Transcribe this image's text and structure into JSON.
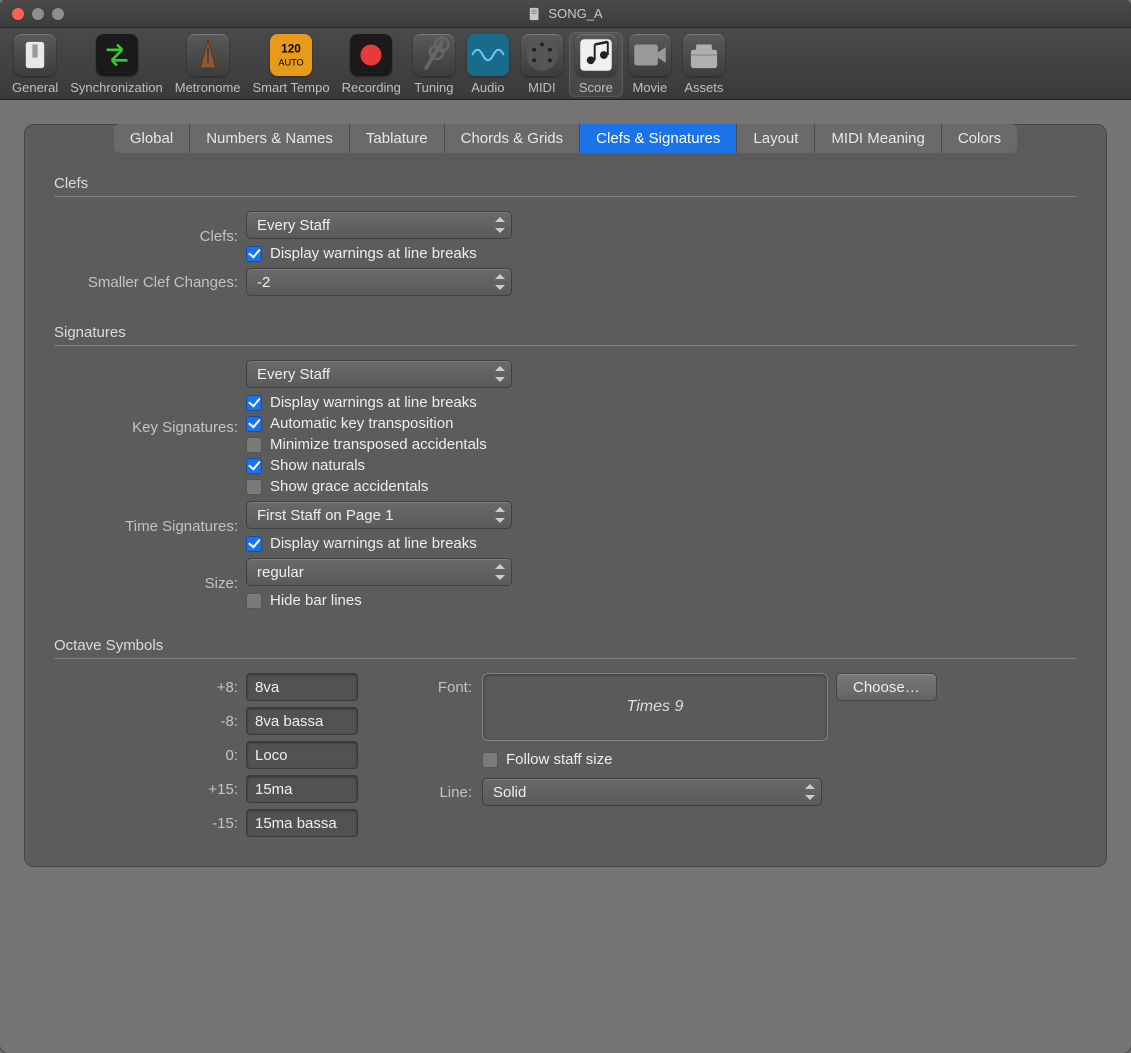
{
  "window_title": "SONG_A",
  "toolbar": [
    {
      "id": "general",
      "label": "General"
    },
    {
      "id": "sync",
      "label": "Synchronization"
    },
    {
      "id": "metronome",
      "label": "Metronome"
    },
    {
      "id": "smart-tempo",
      "label": "Smart Tempo"
    },
    {
      "id": "recording",
      "label": "Recording"
    },
    {
      "id": "tuning",
      "label": "Tuning"
    },
    {
      "id": "audio",
      "label": "Audio"
    },
    {
      "id": "midi",
      "label": "MIDI"
    },
    {
      "id": "score",
      "label": "Score",
      "active": true
    },
    {
      "id": "movie",
      "label": "Movie"
    },
    {
      "id": "assets",
      "label": "Assets"
    }
  ],
  "tabs": [
    "Global",
    "Numbers & Names",
    "Tablature",
    "Chords & Grids",
    "Clefs & Signatures",
    "Layout",
    "MIDI Meaning",
    "Colors"
  ],
  "active_tab": "Clefs & Signatures",
  "sections": {
    "clefs_title": "Clefs",
    "signatures_title": "Signatures",
    "octave_title": "Octave Symbols"
  },
  "labels": {
    "clefs": "Clefs:",
    "smaller_clef": "Smaller Clef Changes:",
    "key_sig": "Key Signatures:",
    "time_sig": "Time Signatures:",
    "size": "Size:",
    "plus8": "+8:",
    "minus8": "-8:",
    "zero": "0:",
    "plus15": "+15:",
    "minus15": "-15:",
    "font": "Font:",
    "line": "Line:",
    "choose": "Choose…"
  },
  "values": {
    "clefs": "Every Staff",
    "smaller_clef": "-2",
    "key_sig": "Every Staff",
    "time_sig": "First Staff on Page 1",
    "size": "regular",
    "plus8": "8va",
    "minus8": "8va bassa",
    "zero": "Loco",
    "plus15": "15ma",
    "minus15": "15ma bassa",
    "font_preview": "Times 9",
    "line": "Solid"
  },
  "checks": {
    "clef_warn": {
      "label": "Display warnings at line breaks",
      "checked": true
    },
    "key_warn": {
      "label": "Display warnings at line breaks",
      "checked": true
    },
    "auto_trans": {
      "label": "Automatic key transposition",
      "checked": true
    },
    "min_acc": {
      "label": "Minimize transposed accidentals",
      "checked": false
    },
    "show_nat": {
      "label": "Show naturals",
      "checked": true
    },
    "show_grace": {
      "label": "Show grace accidentals",
      "checked": false
    },
    "time_warn": {
      "label": "Display warnings at line breaks",
      "checked": true
    },
    "hide_bars": {
      "label": "Hide bar lines",
      "checked": false
    },
    "follow_staff": {
      "label": "Follow staff size",
      "checked": false
    }
  }
}
